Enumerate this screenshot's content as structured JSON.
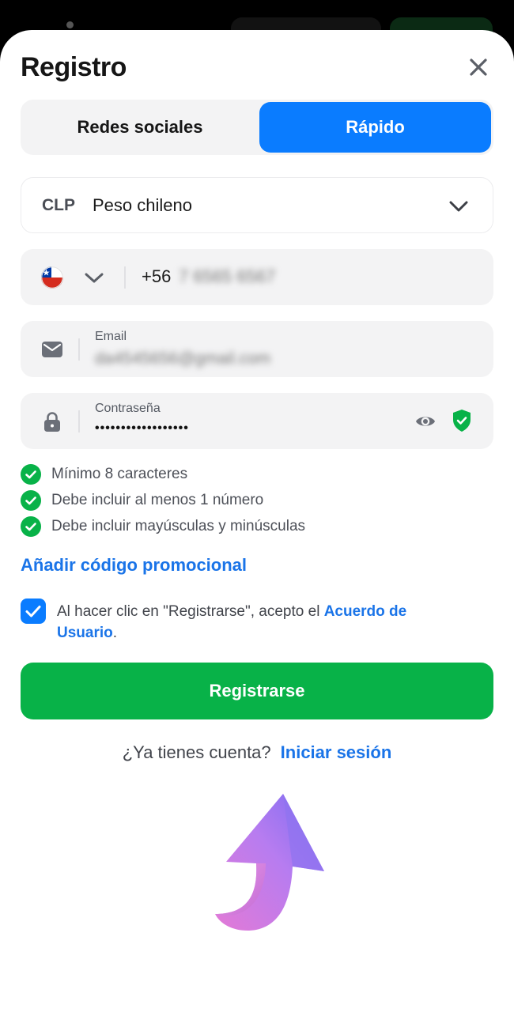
{
  "header": {
    "title": "Registro"
  },
  "tabs": [
    {
      "label": "Redes sociales",
      "active": false
    },
    {
      "label": "Rápido",
      "active": true
    }
  ],
  "currency": {
    "code": "CLP",
    "name": "Peso chileno"
  },
  "phone": {
    "prefix": "+56",
    "number_masked": "7 6565 6567"
  },
  "email": {
    "label": "Email",
    "value_masked": "da4545656@gmail.com"
  },
  "password": {
    "label": "Contraseña",
    "value": "••••••••••••••••••"
  },
  "password_rules": [
    "Mínimo 8 caracteres",
    "Debe incluir al menos 1 número",
    "Debe incluir mayúsculas y minúsculas"
  ],
  "promo_link": "Añadir código promocional",
  "agreement": {
    "text": "Al hacer clic en \"Registrarse\", acepto el ",
    "link": "Acuerdo de Usuario",
    "end": ".",
    "checked": true
  },
  "register_button": "Registrarse",
  "login": {
    "question": "¿Ya tienes cuenta?",
    "link": "Iniciar sesión"
  },
  "colors": {
    "primary_blue": "#0a7cff",
    "green": "#08b248",
    "link_blue": "#1a74e8"
  }
}
